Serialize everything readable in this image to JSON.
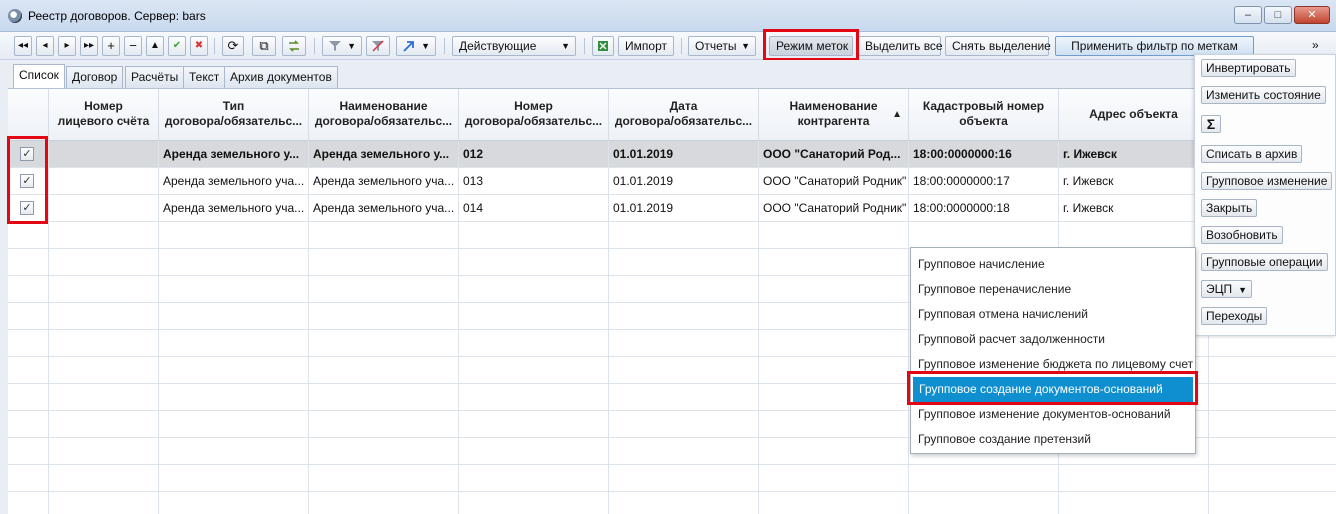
{
  "window": {
    "title": "Реестр договоров. Сервер: bars",
    "controls": [
      "–",
      "□",
      "✕"
    ]
  },
  "toolbar": {
    "nav_first": "◂◂",
    "nav_prev": "◂",
    "nav_next": "▸",
    "nav_last": "▸▸",
    "add": "+",
    "remove": "−",
    "up": "▲",
    "confirm": "✔",
    "cancel": "✖",
    "refresh": "⟳",
    "copy": "⧉",
    "status_filter": "Действующие",
    "import_label": "Импорт",
    "reports_label": "Отчеты",
    "mark_mode_label": "Режим меток",
    "select_all_label": "Выделить все",
    "clear_selection_label": "Снять выделение",
    "apply_filter_label": "Применить фильтр по меткам",
    "overflow": "»"
  },
  "tabs": [
    "Список",
    "Договор",
    "Расчёты",
    "Текст",
    "Архив документов"
  ],
  "grid": {
    "columns": [
      {
        "line1": "Номер",
        "line2": "лицевого счёта"
      },
      {
        "line1": "Тип",
        "line2": "договора/обязательс..."
      },
      {
        "line1": "Наименование",
        "line2": "договора/обязательс..."
      },
      {
        "line1": "Номер",
        "line2": "договора/обязательс..."
      },
      {
        "line1": "Дата",
        "line2": "договора/обязательс..."
      },
      {
        "line1": "Наименование",
        "line2": "контрагента"
      },
      {
        "line1": "Кадастровый номер",
        "line2": "объекта"
      },
      {
        "line1": "Адрес объекта",
        "line2": ""
      }
    ],
    "rows": [
      {
        "checked": "✓",
        "account": "",
        "type": "Аренда земельного у...",
        "name": "Аренда земельного у...",
        "number": "012",
        "date": "01.01.2019",
        "counterparty": "ООО \"Санаторий Род...",
        "cadastral": "18:00:0000000:16",
        "address": "г. Ижевск"
      },
      {
        "checked": "✓",
        "account": "",
        "type": "Аренда земельного уча...",
        "name": "Аренда земельного уча...",
        "number": "013",
        "date": "01.01.2019",
        "counterparty": "ООО \"Санаторий Родник\"",
        "cadastral": "18:00:0000000:17",
        "address": "г. Ижевск"
      },
      {
        "checked": "✓",
        "account": "",
        "type": "Аренда земельного уча...",
        "name": "Аренда земельного уча...",
        "number": "014",
        "date": "01.01.2019",
        "counterparty": "ООО \"Санаторий Родник\"",
        "cadastral": "18:00:0000000:18",
        "address": "г. Ижевск"
      }
    ]
  },
  "side_panel": {
    "invert": "Инвертировать",
    "change_state": "Изменить состояние",
    "sum": "Σ",
    "archive": "Списать в архив",
    "group_change": "Групповое изменение",
    "close": "Закрыть",
    "resume": "Возобновить",
    "group_operations": "Групповые операции",
    "eds": "ЭЦП",
    "transitions": "Переходы"
  },
  "menu": {
    "items": [
      "Групповое начисление",
      "Групповое переначисление",
      "Групповая отмена начислений",
      "Групповой расчет задолженности",
      "Групповое изменение бюджета по лицевому счет",
      "Групповое создание документов-оснований",
      "Групповое изменение документов-оснований",
      "Групповое создание претензий"
    ],
    "highlighted_index": 5
  },
  "colors": {
    "highlight_box": "#e30613",
    "menu_selection": "#0f8fcf"
  }
}
